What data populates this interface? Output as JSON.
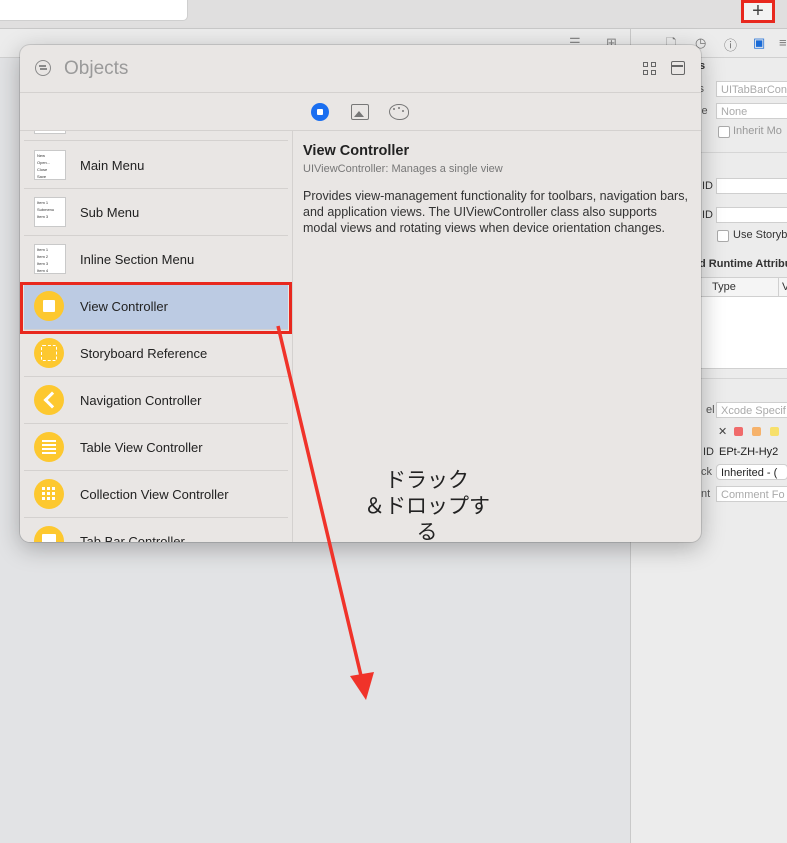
{
  "toolbar": {
    "add_label": "+"
  },
  "inspector": {
    "fields": {
      "class_label": "ss",
      "class_value": "UITabBarCon",
      "module_label": "le",
      "module_value": "None",
      "inherit_label": "Inherit Mo",
      "id1_label": "ID",
      "id2_label": "ID",
      "use_storyboard": "Use Storyb",
      "runtime_attr": "d Runtime Attribu",
      "col_type": "Type",
      "col_v": "V",
      "xlabel_label": "el",
      "xlabel_placeholder": "Xcode Specif",
      "object_id_label": "ID",
      "object_id_value": "EPt-ZH-Hy2",
      "lock_label": "ck",
      "lock_value": "Inherited - (",
      "notes_label": "nt",
      "notes_placeholder": "Comment Fo"
    },
    "partial_title": "s"
  },
  "popup": {
    "title": "Objects",
    "items": [
      {
        "label": "Main Menu",
        "thumb": [
          "New",
          "Open...",
          "",
          "Close",
          "Save"
        ]
      },
      {
        "label": "Sub Menu",
        "thumb": [
          "Item 1",
          "Submenu",
          "Item 3"
        ]
      },
      {
        "label": "Inline Section Menu",
        "thumb": [
          "Item 1",
          "Item 2",
          "Item 3",
          "Item 4"
        ]
      },
      {
        "label": "View Controller"
      },
      {
        "label": "Storyboard Reference"
      },
      {
        "label": "Navigation Controller"
      },
      {
        "label": "Table View Controller"
      },
      {
        "label": "Collection View Controller"
      },
      {
        "label": "Tab Bar Controller"
      }
    ],
    "detail": {
      "title": "View Controller",
      "subtitle": "UIViewController: Manages a single view",
      "body": "Provides view-management functionality for toolbars, navigation bars, and application views. The UIViewController class also supports modal views and rotating views when device orientation changes."
    }
  },
  "annotation": "ドラック\n＆ドロップす\nる",
  "colors": {
    "accent": "#1a6ef0",
    "highlight": "#e8281e",
    "icon_yellow": "#fdc82f",
    "selection": "#bccbe3"
  }
}
